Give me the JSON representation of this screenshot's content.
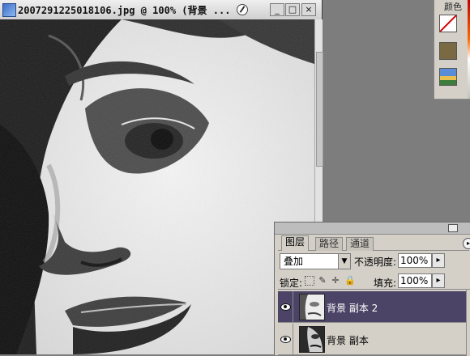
{
  "document": {
    "title": "2007291225018106.jpg @ 100% (背景 ...",
    "buttons": {
      "minimize": "_",
      "maximize": "□",
      "close": "×"
    }
  },
  "swatches": {
    "tab_label": "颜色"
  },
  "layers_panel": {
    "tabs": [
      {
        "label": "图层",
        "active": true
      },
      {
        "label": "路径",
        "active": false
      },
      {
        "label": "通道",
        "active": false
      }
    ],
    "blend_mode": "叠加",
    "opacity_label": "不透明度:",
    "opacity_value": "100%",
    "lock_label": "锁定:",
    "fill_label": "填充:",
    "fill_value": "100%",
    "layers": [
      {
        "name": "背景 副本 2",
        "selected": true,
        "visible": true
      },
      {
        "name": "背景 副本",
        "selected": false,
        "visible": true
      }
    ]
  },
  "colors": {
    "selected_layer": "#4b4466",
    "panel_bg": "#d4d0c8",
    "workspace_bg": "#7d7d7d"
  }
}
